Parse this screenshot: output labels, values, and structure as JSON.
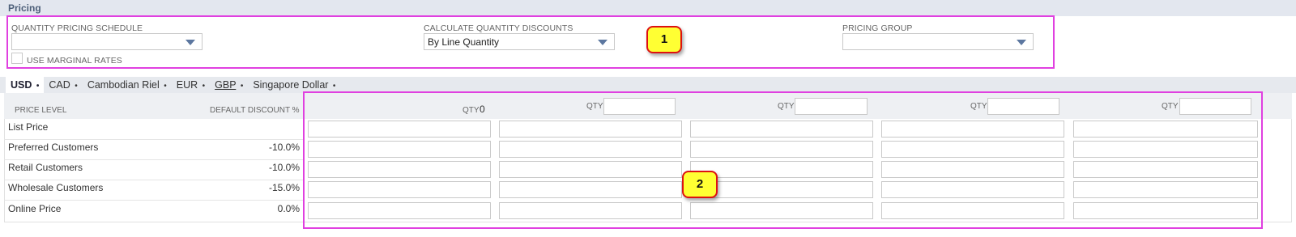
{
  "section": {
    "title": "Pricing"
  },
  "fields": {
    "quantity_pricing_schedule": {
      "label": "QUANTITY PRICING SCHEDULE",
      "value": ""
    },
    "calculate_quantity_discounts": {
      "label": "CALCULATE QUANTITY DISCOUNTS",
      "value": "By Line Quantity"
    },
    "pricing_group": {
      "label": "PRICING GROUP",
      "value": ""
    },
    "use_marginal_rates": {
      "label": "USE MARGINAL RATES",
      "checked": false
    }
  },
  "currency_tabs": [
    {
      "label": "USD",
      "suffix": "•",
      "active": true
    },
    {
      "label": "CAD",
      "suffix": "•",
      "active": false
    },
    {
      "label": "Cambodian Riel",
      "suffix": "•",
      "active": false
    },
    {
      "label": "EUR",
      "suffix": "•",
      "active": false
    },
    {
      "label": "GBP",
      "suffix": "•",
      "active": false
    },
    {
      "label": "Singapore Dollar",
      "suffix": "•",
      "active": false
    }
  ],
  "grid": {
    "header": {
      "price_level": "PRICE LEVEL",
      "default_discount": "DEFAULT DISCOUNT %",
      "qty_label": "QTY",
      "first_qty_value": "0"
    },
    "rows": [
      {
        "name": "List Price",
        "discount": ""
      },
      {
        "name": "Preferred Customers",
        "discount": "-10.0%"
      },
      {
        "name": "Retail Customers",
        "discount": "-10.0%"
      },
      {
        "name": "Wholesale Customers",
        "discount": "-15.0%"
      },
      {
        "name": "Online Price",
        "discount": "0.0%"
      }
    ]
  },
  "callouts": [
    {
      "label": "1"
    },
    {
      "label": "2"
    }
  ],
  "colors": {
    "highlight": "#e040e0",
    "badge_fill": "#ffff33",
    "badge_border": "#dd1111",
    "caret": "#5c77a0"
  }
}
